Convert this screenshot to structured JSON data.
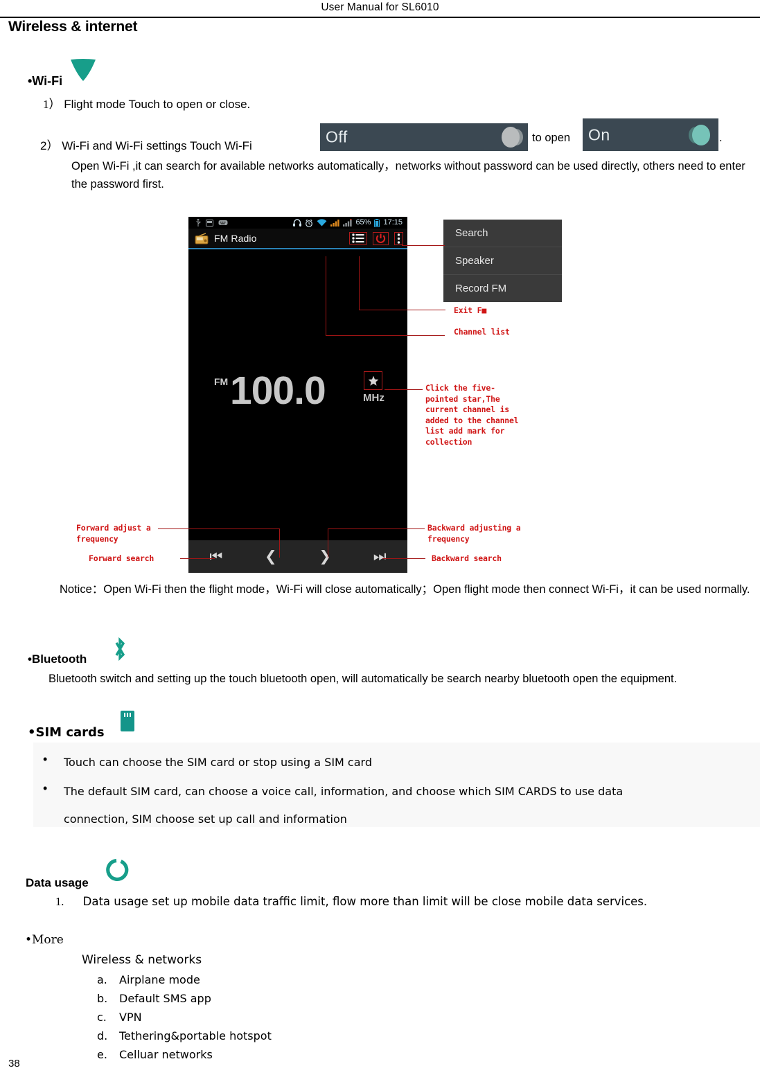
{
  "header": {
    "title": "User Manual for SL6010"
  },
  "page_title": "Wireless & internet",
  "page_number": "38",
  "wifi": {
    "heading": "•Wi-Fi",
    "icon": "wifi-triangle-icon",
    "icon_color": "#179e8a",
    "item1_number": "1）",
    "item1_text": "Flight mode      Touch to open or close.",
    "item2_number": "2）",
    "item2_text": "Wi-Fi and Wi-Fi settings        Touch Wi-Fi",
    "toggle_off_label": "Off",
    "to_open_text": "to open",
    "toggle_on_label": "On",
    "end_period": ".",
    "paragraph": "Open Wi-Fi ,it can search for available networks automatically，networks without password can be used directly, others need to enter the password first."
  },
  "screenshot": {
    "statusbar": {
      "left_icons": [
        "usb-icon",
        "sd-card-icon",
        "keyboard-icon"
      ],
      "right_icons": [
        "headphone-icon",
        "alarm-clock-icon",
        "wifi-signal-icon",
        "signal-bars-icon",
        "signal-bars-2-icon",
        "battery-icon"
      ],
      "battery_percent": "65%",
      "time": "17:15"
    },
    "appbar": {
      "app_icon": "fm-radio-icon",
      "title": "FM Radio",
      "actions": [
        "channel-list-icon",
        "power-icon",
        "overflow-menu-icon"
      ]
    },
    "display": {
      "band": "FM",
      "frequency": "100.0",
      "unit": "MHz",
      "favorite_icon": "star-icon"
    },
    "controls": [
      {
        "icon": "skip-previous-icon",
        "name": "forward-search"
      },
      {
        "icon": "chevron-left-icon",
        "name": "forward-adjust"
      },
      {
        "icon": "chevron-right-icon",
        "name": "backward-adjust"
      },
      {
        "icon": "skip-next-icon",
        "name": "backward-search"
      }
    ],
    "menu": [
      "Search",
      "Speaker",
      "Record FM"
    ],
    "annotations": {
      "exit_fm": "Exit F■",
      "channel_list": "Channel list",
      "star": "Click the five-\npointed star,The\ncurrent channel is\nadded to the channel\nlist add mark for\ncollection",
      "forward_adjust": "Forward adjust a\nfrequency",
      "forward_search": "Forward search",
      "backward_adjust": "Backward adjusting a\nfrequency",
      "backward_search": "Backward search"
    }
  },
  "notice": {
    "text": "Notice：Open Wi-Fi then the flight mode，Wi-Fi will close automatically；Open flight mode then connect Wi-Fi，it can be used normally."
  },
  "bluetooth": {
    "heading": "•Bluetooth",
    "icon": "bluetooth-icon",
    "icon_color": "#179e8a",
    "body": "Bluetooth switch and setting up the touch bluetooth open, will automatically be search nearby bluetooth open the equipment."
  },
  "sim_cards": {
    "heading": "•SIM cards",
    "icon": "sim-card-icon",
    "icon_color": "#179e8a",
    "bullets": [
      "Touch can choose the SIM card or stop using a SIM card",
      "The default SIM card, can choose a voice call, information, and choose which SIM CARDS to use data",
      "connection, SIM choose set up call and information"
    ]
  },
  "data_usage": {
    "heading": "Data usage",
    "icon": "data-usage-circle-icon",
    "icon_color": "#179e8a",
    "item_number": "1.",
    "item_text": "Data usage    set up mobile data traffic limit, flow more than limit will be close mobile data services."
  },
  "more": {
    "heading": "•More",
    "subheading": "Wireless & networks",
    "items": [
      {
        "letter": "a.",
        "label": "Airplane mode"
      },
      {
        "letter": "b.",
        "label": "Default SMS app"
      },
      {
        "letter": "c.",
        "label": "VPN"
      },
      {
        "letter": "d.",
        "label": "Tethering&portable hotspot"
      },
      {
        "letter": "e.",
        "label": "Celluar networks"
      }
    ]
  }
}
